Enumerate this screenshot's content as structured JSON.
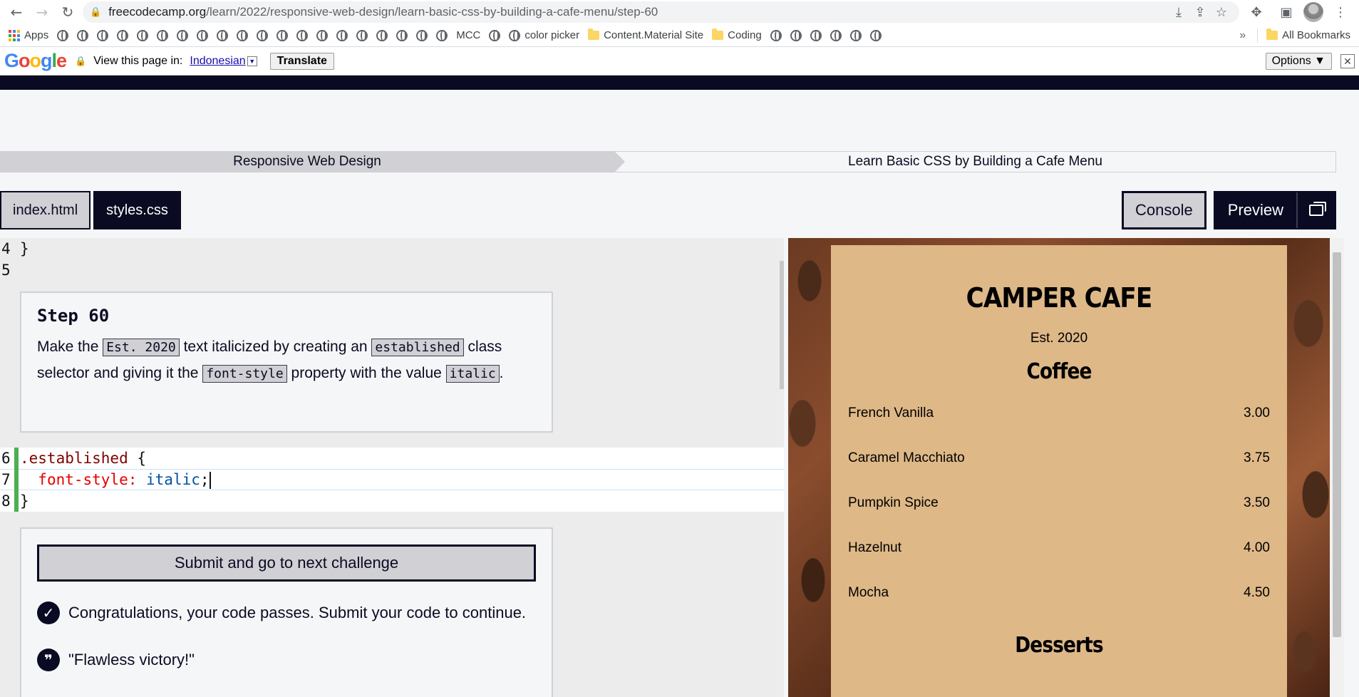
{
  "browser": {
    "url_host": "freecodecamp.org",
    "url_path": "/learn/2022/responsive-web-design/learn-basic-css-by-building-a-cafe-menu/step-60"
  },
  "bookmarks": {
    "apps_label": "Apps",
    "named": [
      "MCC",
      "color picker",
      "Content.Material Site",
      "Coding"
    ],
    "more": "»",
    "all_bookmarks": "All Bookmarks"
  },
  "translate_bar": {
    "view_text": "View this page in:",
    "language": "Indonesian",
    "translate_button": "Translate",
    "options_button": "Options ▼",
    "close": "✕"
  },
  "breadcrumb": {
    "course": "Responsive Web Design",
    "project": "Learn Basic CSS by Building a Cafe Menu"
  },
  "tabs": {
    "file1": "index.html",
    "file2": "styles.css",
    "console": "Console",
    "preview": "Preview"
  },
  "editor": {
    "lines_before": [
      {
        "num": "4",
        "code": "}"
      },
      {
        "num": "5",
        "code": ""
      }
    ],
    "editable": [
      {
        "num": "6",
        "selector": ".established",
        "brace": " {"
      },
      {
        "num": "7",
        "prop": "font-style:",
        "value": " italic",
        "semi": ";"
      },
      {
        "num": "8",
        "close": "}"
      }
    ]
  },
  "step": {
    "title": "Step 60",
    "desc_1": "Make the ",
    "code_1": "Est. 2020",
    "desc_2": " text italicized by creating an ",
    "code_2": "established",
    "desc_3": " class selector and giving it the ",
    "code_3": "font-style",
    "desc_4": " property with the value ",
    "code_4": "italic",
    "desc_5": "."
  },
  "submit": {
    "button": "Submit and go to next challenge",
    "pass_text": "Congratulations, your code passes. Submit your code to continue.",
    "quote": "\"Flawless victory!\""
  },
  "preview_menu": {
    "title": "CAMPER CAFE",
    "est": "Est. 2020",
    "section_coffee": "Coffee",
    "items": [
      {
        "name": "French Vanilla",
        "price": "3.00"
      },
      {
        "name": "Caramel Macchiato",
        "price": "3.75"
      },
      {
        "name": "Pumpkin Spice",
        "price": "3.50"
      },
      {
        "name": "Hazelnut",
        "price": "4.00"
      },
      {
        "name": "Mocha",
        "price": "4.50"
      }
    ],
    "section_desserts": "Desserts"
  },
  "colors": {
    "fcc_dark": "#0a0a23",
    "fcc_gray": "#d0d0d5",
    "menu_bg": "#deb887",
    "gutter_green": "#4caf50"
  }
}
